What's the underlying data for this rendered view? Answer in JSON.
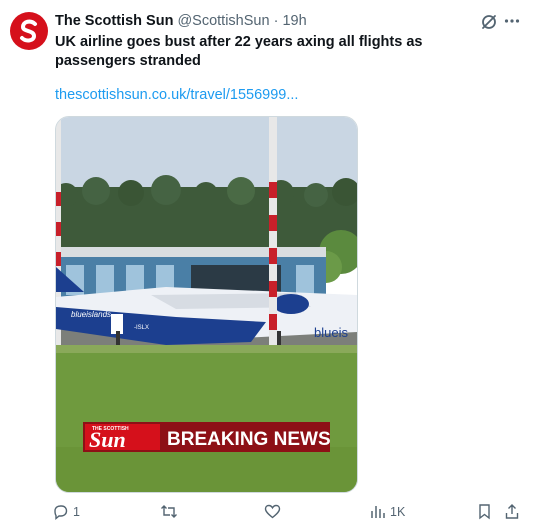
{
  "tweet": {
    "display_name": "The Scottish Sun",
    "handle": "@ScottishSun",
    "separator": "·",
    "time": "19h",
    "text": "UK airline goes bust after 22 years axing all flights as passengers stranded",
    "link": "thescottishsun.co.uk/travel/1556999...",
    "media": {
      "airline_logo": "blueislands",
      "plane_label": "blueis",
      "registration": "-ISLX",
      "banner_brand": "Sun",
      "banner_brand_small": "THE SCOTTISH",
      "banner_text": "BREAKING NEWS"
    }
  },
  "actions": {
    "reply_count": "1",
    "retweet_count": "",
    "like_count": "",
    "views_count": "1K"
  },
  "colors": {
    "brand_red": "#d5101b",
    "link_blue": "#1d9bf0",
    "muted_text": "#536471"
  },
  "icons": {
    "avatar": "scottish-sun-logo",
    "grok": "grok-icon",
    "more": "more-icon",
    "reply": "reply-icon",
    "retweet": "retweet-icon",
    "like": "heart-icon",
    "views": "views-icon",
    "bookmark": "bookmark-icon",
    "share": "share-icon"
  }
}
